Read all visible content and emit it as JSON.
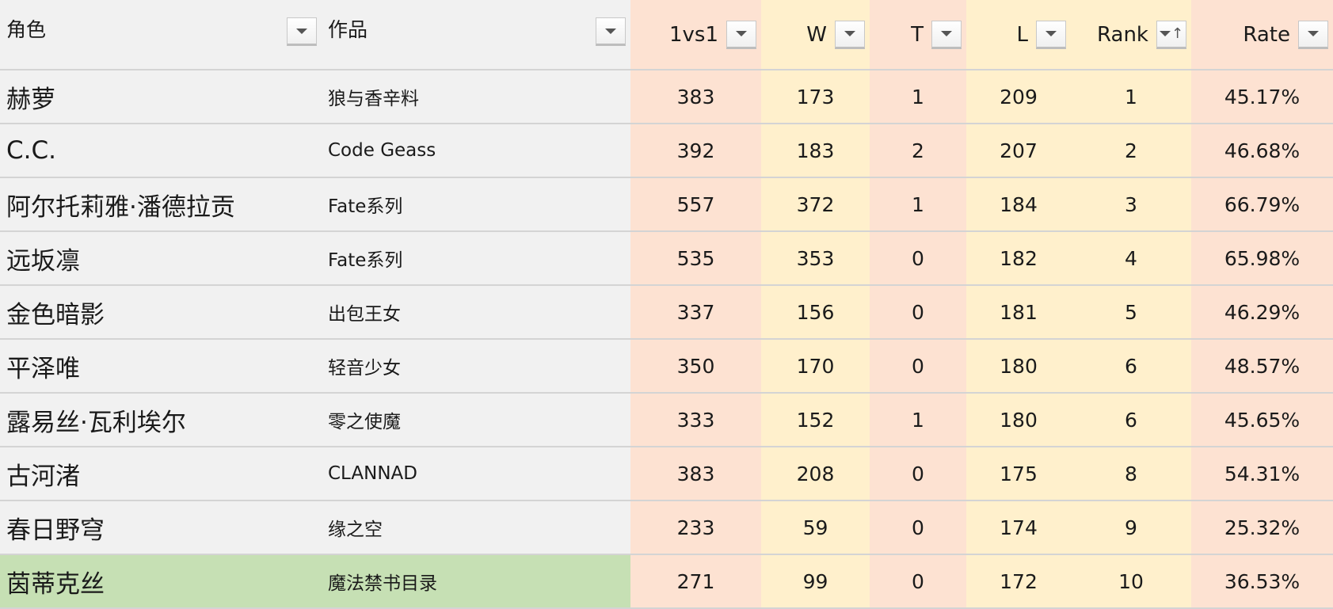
{
  "columns": {
    "name": "角色",
    "work": "作品",
    "matches": "1vs1",
    "wins": "W",
    "ties": "T",
    "losses": "L",
    "rank": "Rank",
    "rate": "Rate"
  },
  "filter_icon": "dropdown-arrow",
  "sort_icon": "sort-ascending-arrow",
  "rows": [
    {
      "name": "赫萝",
      "work": "狼与香辛料",
      "matches": "383",
      "wins": "173",
      "ties": "1",
      "losses": "209",
      "rank": "1",
      "rate": "45.17%"
    },
    {
      "name": "C.C.",
      "work": "Code Geass",
      "matches": "392",
      "wins": "183",
      "ties": "2",
      "losses": "207",
      "rank": "2",
      "rate": "46.68%"
    },
    {
      "name": "阿尔托莉雅·潘德拉贡",
      "work": "Fate系列",
      "matches": "557",
      "wins": "372",
      "ties": "1",
      "losses": "184",
      "rank": "3",
      "rate": "66.79%"
    },
    {
      "name": "远坂凛",
      "work": "Fate系列",
      "matches": "535",
      "wins": "353",
      "ties": "0",
      "losses": "182",
      "rank": "4",
      "rate": "65.98%"
    },
    {
      "name": "金色暗影",
      "work": "出包王女",
      "matches": "337",
      "wins": "156",
      "ties": "0",
      "losses": "181",
      "rank": "5",
      "rate": "46.29%"
    },
    {
      "name": "平泽唯",
      "work": "轻音少女",
      "matches": "350",
      "wins": "170",
      "ties": "0",
      "losses": "180",
      "rank": "6",
      "rate": "48.57%"
    },
    {
      "name": "露易丝·瓦利埃尔",
      "work": "零之使魔",
      "matches": "333",
      "wins": "152",
      "ties": "1",
      "losses": "180",
      "rank": "6",
      "rate": "45.65%"
    },
    {
      "name": "古河渚",
      "work": "CLANNAD",
      "matches": "383",
      "wins": "208",
      "ties": "0",
      "losses": "175",
      "rank": "8",
      "rate": "54.31%"
    },
    {
      "name": "春日野穹",
      "work": "缘之空",
      "matches": "233",
      "wins": "59",
      "ties": "0",
      "losses": "174",
      "rank": "9",
      "rate": "25.32%"
    },
    {
      "name": "茵蒂克丝",
      "work": "魔法禁书目录",
      "matches": "271",
      "wins": "99",
      "ties": "0",
      "losses": "172",
      "rank": "10",
      "rate": "36.53%"
    }
  ],
  "highlight_color": "#c6e0b4",
  "colors": {
    "text_col_bg": "#f1f1f1",
    "pink_col_bg": "#fde2d2",
    "yellow_col_bg": "#fff0cc"
  }
}
